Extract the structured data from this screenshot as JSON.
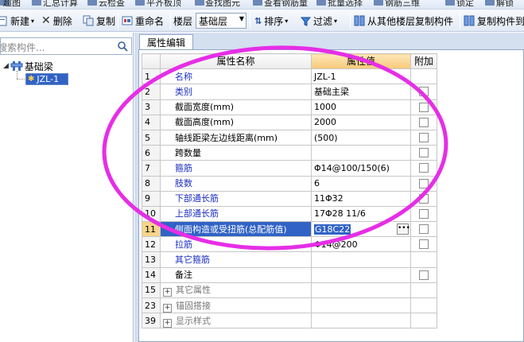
{
  "top_strip": [
    "超图",
    "汇总计算",
    "云检查",
    "平齐板顶",
    "查找图元",
    "查看钢筋量",
    "批量选择",
    "钢筋三维",
    "锁定",
    "解锁"
  ],
  "toolbar": {
    "new_label": "新建",
    "delete_label": "删除",
    "copy_label": "复制",
    "rename_label": "重命名",
    "floor_label": "楼层",
    "floor_value": "基础层",
    "sort_label": "排序",
    "filter_label": "过滤",
    "copy_from_floor_label": "从其他楼层复制构件",
    "copy_to_label": "复制构件到"
  },
  "search": {
    "placeholder": "搜索构件..."
  },
  "tree": {
    "root_label": "基础梁",
    "child_label": "JZL-1"
  },
  "tab": {
    "label": "属性编辑"
  },
  "grid": {
    "headers": {
      "name": "属性名称",
      "value": "属性值",
      "extra": "附加"
    },
    "rows": [
      {
        "num": "1",
        "name": "名称",
        "value": "JZL-1",
        "style": "blue",
        "checkbox": false,
        "expander": false
      },
      {
        "num": "2",
        "name": "类别",
        "value": "基础主梁",
        "style": "blue",
        "checkbox": true,
        "expander": false
      },
      {
        "num": "3",
        "name": "截面宽度(mm)",
        "value": "1000",
        "style": "black",
        "checkbox": true,
        "expander": false
      },
      {
        "num": "4",
        "name": "截面高度(mm)",
        "value": "2000",
        "style": "black",
        "checkbox": true,
        "expander": false
      },
      {
        "num": "5",
        "name": "轴线距梁左边线距离(mm)",
        "value": "(500)",
        "style": "black",
        "checkbox": true,
        "expander": false
      },
      {
        "num": "6",
        "name": "跨数量",
        "value": "",
        "style": "black",
        "checkbox": true,
        "expander": false
      },
      {
        "num": "7",
        "name": "箍筋",
        "value": "Φ14@100/150(6)",
        "style": "blue",
        "checkbox": true,
        "expander": false
      },
      {
        "num": "8",
        "name": "肢数",
        "value": "6",
        "style": "blue",
        "checkbox": true,
        "expander": false
      },
      {
        "num": "9",
        "name": "下部通长筋",
        "value": "11Φ32",
        "style": "blue",
        "checkbox": true,
        "expander": false
      },
      {
        "num": "10",
        "name": "上部通长筋",
        "value": "17Φ28 11/6",
        "style": "blue",
        "checkbox": true,
        "expander": false
      },
      {
        "num": "11",
        "name": "侧面构造或受扭筋(总配筋值)",
        "value": "G18C22",
        "style": "blue",
        "checkbox": true,
        "expander": false,
        "selected": true
      },
      {
        "num": "12",
        "name": "拉筋",
        "value": "Φ14@200",
        "style": "blue",
        "checkbox": true,
        "expander": false
      },
      {
        "num": "13",
        "name": "其它箍筋",
        "value": "",
        "style": "blue",
        "checkbox": false,
        "expander": false
      },
      {
        "num": "14",
        "name": "备注",
        "value": "",
        "style": "black",
        "checkbox": true,
        "expander": false
      },
      {
        "num": "15",
        "name": "其它属性",
        "value": "",
        "style": "gray",
        "checkbox": false,
        "expander": true
      },
      {
        "num": "23",
        "name": "锚固搭接",
        "value": "",
        "style": "gray",
        "checkbox": false,
        "expander": true
      },
      {
        "num": "39",
        "name": "显示样式",
        "value": "",
        "style": "gray",
        "checkbox": false,
        "expander": true
      }
    ]
  },
  "colors": {
    "annotation": "#e62ee6",
    "selection": "#3163c6",
    "value_header": "#f7c978",
    "property_blue": "#1c2fc1"
  }
}
